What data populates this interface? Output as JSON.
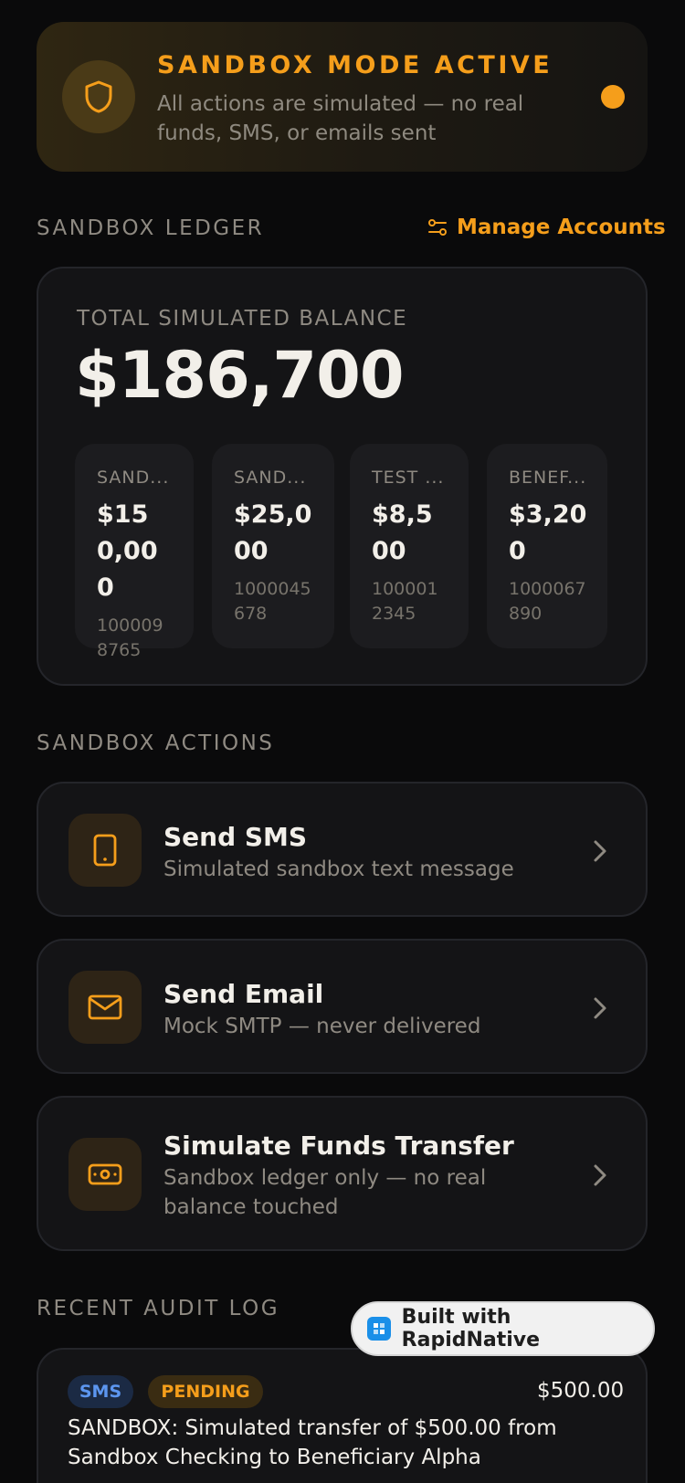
{
  "banner": {
    "title": "SANDBOX MODE ACTIVE",
    "subtitle": "All actions are simulated — no real funds, SMS, or emails sent",
    "icon": "shield-icon"
  },
  "ledger": {
    "section_label": "SANDBOX LEDGER",
    "manage_label": "Manage Accounts",
    "total_label": "TOTAL SIMULATED BALANCE",
    "total_value": "$186,700",
    "accounts": [
      {
        "name": "SAND...",
        "balance": "$150,000",
        "number": "1000098765"
      },
      {
        "name": "SAND...",
        "balance": "$25,000",
        "number": "1000045678"
      },
      {
        "name": "TEST ...",
        "balance": "$8,500",
        "number": "1000012345"
      },
      {
        "name": "BENEF...",
        "balance": "$3,200",
        "number": "1000067890"
      }
    ]
  },
  "actions": {
    "section_label": "SANDBOX ACTIONS",
    "items": [
      {
        "title": "Send SMS",
        "subtitle": "Simulated sandbox text message",
        "icon": "phone-icon"
      },
      {
        "title": "Send Email",
        "subtitle": "Mock SMTP — never delivered",
        "icon": "mail-icon"
      },
      {
        "title": "Simulate Funds Transfer",
        "subtitle": "Sandbox ledger only — no real balance touched",
        "icon": "cash-icon"
      }
    ]
  },
  "audit": {
    "section_label": "RECENT AUDIT LOG",
    "entries": [
      {
        "type": "SMS",
        "status": "PENDING",
        "amount": "$500.00",
        "description": "SANDBOX: Simulated transfer of $500.00 from Sandbox Checking to Beneficiary Alpha"
      }
    ]
  },
  "badge": {
    "label": "Built with RapidNative"
  },
  "colors": {
    "accent": "#f59e1b",
    "background": "#0a0a0b",
    "card": "#141416",
    "sms_badge": "#5c96f0"
  }
}
